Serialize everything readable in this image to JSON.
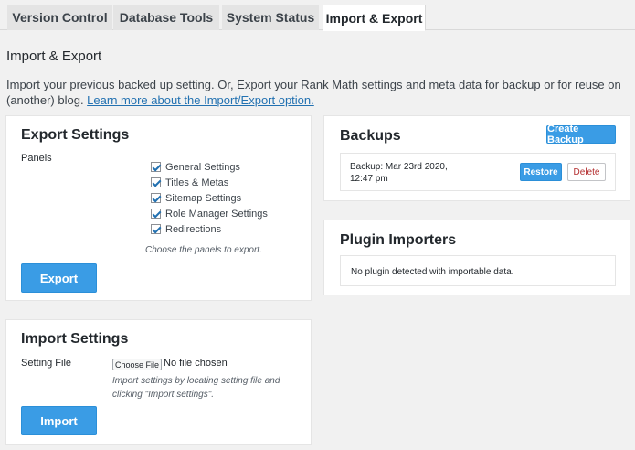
{
  "tabs": [
    {
      "label": "Version Control"
    },
    {
      "label": "Database Tools"
    },
    {
      "label": "System Status"
    },
    {
      "label": "Import & Export"
    }
  ],
  "page": {
    "title": "Import & Export",
    "intro_text": "Import your previous backed up setting. Or, Export your Rank Math settings and meta data for backup or for reuse on (another) blog. ",
    "intro_link": "Learn more about the Import/Export option."
  },
  "export": {
    "title": "Export Settings",
    "panels_label": "Panels",
    "options": [
      {
        "label": "General Settings",
        "checked": true
      },
      {
        "label": "Titles & Metas",
        "checked": true
      },
      {
        "label": "Sitemap Settings",
        "checked": true
      },
      {
        "label": "Role Manager Settings",
        "checked": true
      },
      {
        "label": "Redirections",
        "checked": true
      }
    ],
    "hint": "Choose the panels to export.",
    "button": "Export"
  },
  "import": {
    "title": "Import Settings",
    "file_label": "Setting File",
    "choose_file": "Choose File",
    "no_file": "No file chosen",
    "hint_line1": "Import settings by locating setting file and",
    "hint_line2": "clicking \"Import settings\".",
    "button": "Import"
  },
  "backups": {
    "title": "Backups",
    "create_button": "Create Backup",
    "entry_line1": "Backup: Mar 23rd 2020,",
    "entry_line2": "12:47 pm",
    "restore_button": "Restore",
    "delete_button": "Delete"
  },
  "importers": {
    "title": "Plugin Importers",
    "message": "No plugin detected with importable data."
  },
  "colors": {
    "primary": "#3a9ce5",
    "link": "#2271b1",
    "danger": "#b32d2e",
    "background": "#f1f1f1"
  }
}
